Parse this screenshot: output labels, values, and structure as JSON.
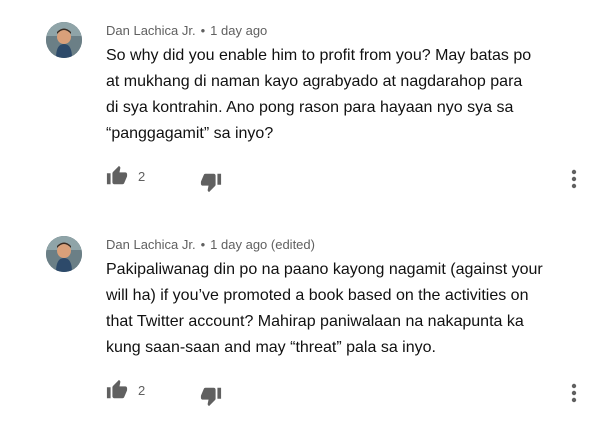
{
  "comments": [
    {
      "author": "Dan Lachica Jr.",
      "separator": "•",
      "timestamp": "1 day ago",
      "lines": [
        "So why did you enable him to profit from you? May batas po",
        "at mukhang di naman kayo agrabyado at nagdarahop para",
        "di sya kontrahin. Ano pong rason para hayaan nyo sya sa",
        "“panggagamit” sa inyo?"
      ],
      "like_count": "2",
      "icons": {
        "like": "thumbs-up-icon",
        "dislike": "thumbs-down-icon",
        "menu": "more-vert-icon"
      }
    },
    {
      "author": "Dan Lachica Jr.",
      "separator": "•",
      "timestamp": "1 day ago (edited)",
      "lines": [
        "Pakipaliwanag din po na paano kayong nagamit (against your",
        "will ha) if you’ve promoted a book based on the activities on",
        "that Twitter account? Mahirap paniwalaan na nakapunta ka",
        "kung saan-saan and may “threat” pala sa inyo."
      ],
      "like_count": "2",
      "icons": {
        "like": "thumbs-up-icon",
        "dislike": "thumbs-down-icon",
        "menu": "more-vert-icon"
      }
    }
  ],
  "colors": {
    "meta_text": "#606060",
    "body_text": "#111111",
    "icon": "#606060"
  }
}
